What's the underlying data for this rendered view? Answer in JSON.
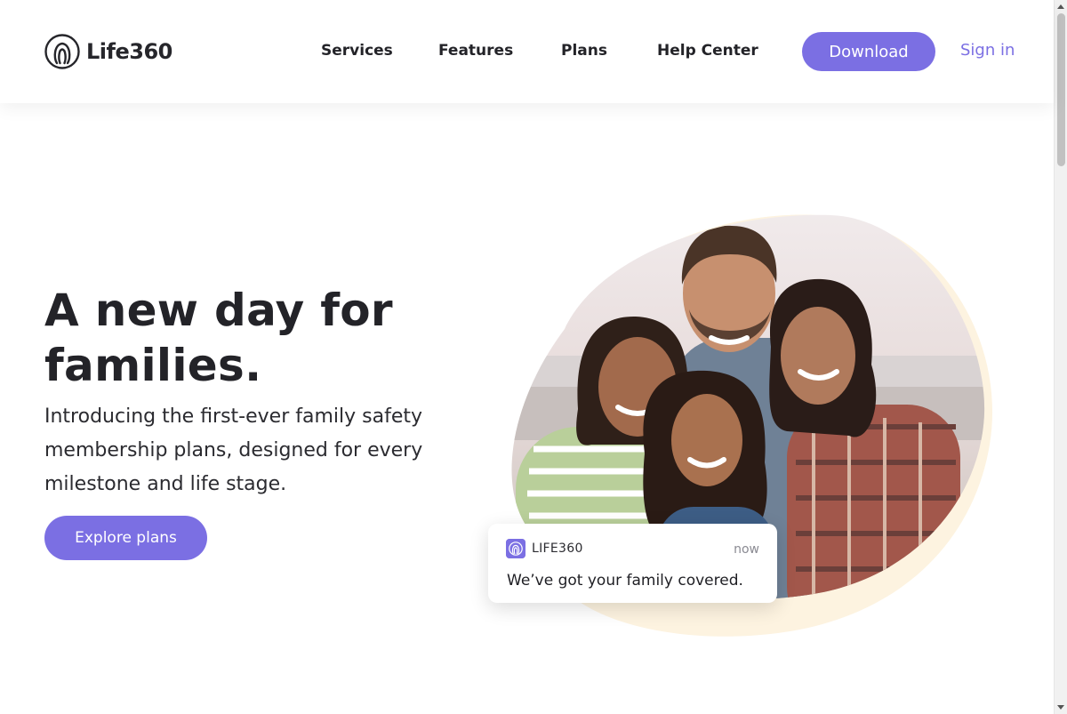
{
  "header": {
    "brand": "Life360",
    "nav": [
      "Services",
      "Features",
      "Plans",
      "Help Center"
    ],
    "download_label": "Download",
    "signin_label": "Sign in"
  },
  "hero": {
    "title_line1": "A new day for",
    "title_line2": "families.",
    "subtitle": "Introducing the first-ever family safety membership plans, designed for every milestone and life stage.",
    "cta_label": "Explore plans"
  },
  "notification": {
    "app_name": "LIFE360",
    "time": "now",
    "message": "We’ve got your family covered."
  },
  "colors": {
    "accent": "#7b6fe3",
    "text": "#232328",
    "blob_back": "#fdf3e0"
  },
  "icons": {
    "logo": "life360-logo-icon",
    "notification": "life360-app-icon"
  }
}
